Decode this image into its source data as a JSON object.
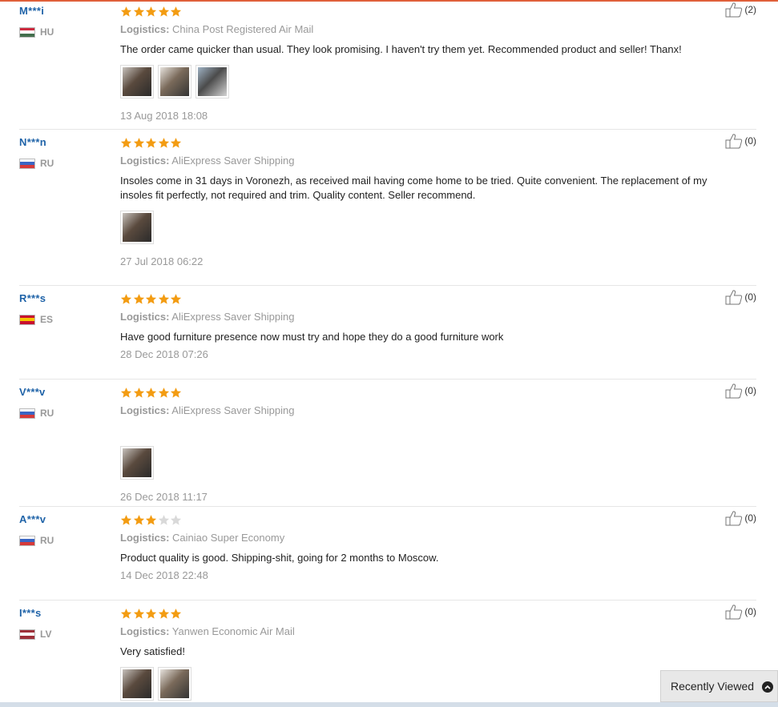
{
  "reviews": [
    {
      "user": "M***i",
      "country": "HU",
      "flag": [
        "#cd2a3e",
        "#ffffff",
        "#436f4d"
      ],
      "rating": 5,
      "logistics_label": "Logistics:",
      "logistics": "China Post Registered Air Mail",
      "feedback": "The order came quicker than usual. They look promising. I haven't try them yet. Recommended product and seller! Thanx!",
      "photos": [
        "insole-photo-1",
        "insole-photo-2",
        "insole-photo-3"
      ],
      "date": "13 Aug 2018 18:08",
      "helpful": "(2)"
    },
    {
      "user": "N***n",
      "country": "RU",
      "flag": [
        "#ffffff",
        "#3a66c4",
        "#d63a3a"
      ],
      "rating": 5,
      "logistics_label": "Logistics:",
      "logistics": "AliExpress Saver Shipping",
      "feedback": "Insoles come in 31 days in Voronezh, as received mail having come home to be tried. Quite convenient. The replacement of my insoles fit perfectly, not required and trim. Quality content. Seller recommend.",
      "photos": [
        "insole-photo-1"
      ],
      "date": "27 Jul 2018 06:22",
      "helpful": "(0)"
    },
    {
      "user": "R***s",
      "country": "ES",
      "flag": [
        "#c8102e",
        "#f5c400",
        "#c8102e"
      ],
      "rating": 5,
      "logistics_label": "Logistics:",
      "logistics": "AliExpress Saver Shipping",
      "feedback": "Have good furniture presence now must try and hope they do a good furniture work",
      "photos": [],
      "date": "28 Dec 2018 07:26",
      "helpful": "(0)"
    },
    {
      "user": "V***v",
      "country": "RU",
      "flag": [
        "#ffffff",
        "#3a66c4",
        "#d63a3a"
      ],
      "rating": 5,
      "logistics_label": "Logistics:",
      "logistics": "AliExpress Saver Shipping",
      "feedback": "",
      "photos": [
        "insole-photo-1"
      ],
      "date": "26 Dec 2018 11:17",
      "helpful": "(0)"
    },
    {
      "user": "A***v",
      "country": "RU",
      "flag": [
        "#ffffff",
        "#3a66c4",
        "#d63a3a"
      ],
      "rating": 3,
      "logistics_label": "Logistics:",
      "logistics": "Cainiao Super Economy",
      "feedback": "Product quality is good. Shipping-shit, going for 2 months to Moscow.",
      "photos": [],
      "date": "14 Dec 2018 22:48",
      "helpful": "(0)"
    },
    {
      "user": "I***s",
      "country": "LV",
      "flag": [
        "#9e3039",
        "#ffffff",
        "#9e3039"
      ],
      "rating": 5,
      "logistics_label": "Logistics:",
      "logistics": "Yanwen Economic Air Mail",
      "feedback": "Very satisfied!",
      "photos": [
        "insole-photo-1",
        "insole-photo-2"
      ],
      "date": "",
      "helpful": "(0)"
    }
  ],
  "recently_viewed": {
    "label": "Recently Viewed",
    "icon": "chevron-up-icon"
  },
  "colors": {
    "star_on": "#f39c12",
    "star_off": "#d9d9d9",
    "user_link": "#1f63a8",
    "top_accent": "#e0603a"
  }
}
